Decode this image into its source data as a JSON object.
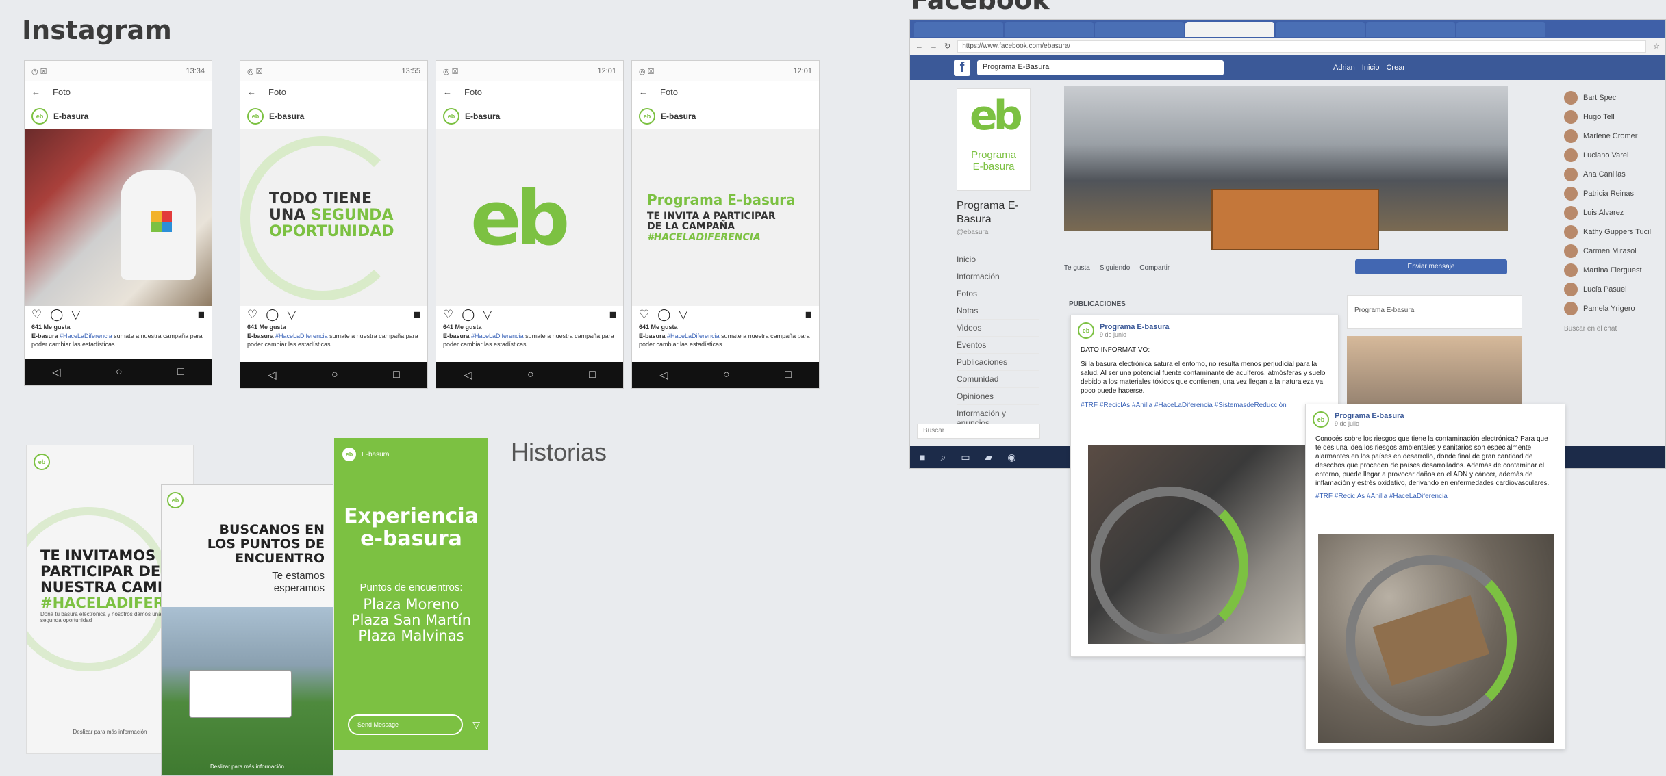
{
  "sections": {
    "instagram_title": "Instagram",
    "facebook_title": "Facebook",
    "stories_title": "Historias"
  },
  "colors": {
    "brand_green": "#7cc142",
    "fb_blue": "#3b5998",
    "bg": "#e9ebee"
  },
  "instagram_posts": [
    {
      "status_time": "13:34",
      "back_label": "Foto",
      "account": "E-basura",
      "likes": "641 Me gusta",
      "caption_account": "E-basura",
      "caption_tag": "#HaceLaDiferencia",
      "caption_rest": "sumate a nuestra campaña para poder cambiar las estadísticas"
    },
    {
      "status_time": "13:55",
      "back_label": "Foto",
      "account": "E-basura",
      "headline": [
        "TODO TIENE",
        "UNA ",
        "SEGUNDA",
        "OPORTUNIDAD"
      ],
      "likes": "641 Me gusta",
      "caption_account": "E-basura",
      "caption_tag": "#HaceLaDiferencia",
      "caption_rest": "sumate a nuestra campaña para poder cambiar las estadísticas"
    },
    {
      "status_time": "12:01",
      "back_label": "Foto",
      "account": "E-basura",
      "logo": "eb",
      "likes": "641 Me gusta",
      "caption_account": "E-basura",
      "caption_tag": "#HaceLaDiferencia",
      "caption_rest": "sumate a nuestra campaña para poder cambiar las estadísticas"
    },
    {
      "status_time": "12:01",
      "back_label": "Foto",
      "account": "E-basura",
      "headline_green": "Programa E-basura",
      "headline_dark": [
        "TE INVITA A PARTICIPAR",
        "DE LA CAMPAÑA"
      ],
      "headline_tag": "#HACELADIFERENCIA",
      "likes": "641 Me gusta",
      "caption_account": "E-basura",
      "caption_tag": "#HaceLaDiferencia",
      "caption_rest": "sumate a nuestra campaña para poder cambiar las estadísticas"
    }
  ],
  "stories": [
    {
      "text": [
        "TE INVITAMOS A",
        "PARTICIPAR DE",
        "NUESTRA CAMPAÑ"
      ],
      "tag": "#HACELADIFEREN",
      "small": "Dona tu basura electrónica y nosotros damos una segunda oportunidad",
      "footer": "Deslizar para más información"
    },
    {
      "text": [
        "BUSCANOS EN",
        "LOS PUNTOS DE",
        "ENCUENTRO"
      ],
      "sub": [
        "Te estamos",
        "esperamos"
      ],
      "footer": "Deslizar para más información"
    },
    {
      "account": "E-basura",
      "title": [
        "Experiencia",
        "e-basura"
      ],
      "subtitle": "Puntos de encuentros:",
      "places": [
        "Plaza Moreno",
        "Plaza San Martín",
        "Plaza Malvinas"
      ],
      "reply": "Send Message"
    }
  ],
  "facebook": {
    "url": "https://www.facebook.com/ebasura/",
    "search_value": "Programa E-Basura",
    "nav": [
      "Adrian",
      "Inicio",
      "Crear"
    ],
    "page_logo": "eb",
    "page_logo_text": [
      "Programa",
      "E-basura"
    ],
    "page_name": [
      "Programa E-",
      "Basura"
    ],
    "page_handle": "@ebasura",
    "sidebar": [
      "Inicio",
      "Información",
      "Fotos",
      "Notas",
      "Videos",
      "Eventos",
      "Publicaciones",
      "Comunidad",
      "Opiniones",
      "Información y anuncios"
    ],
    "actions": [
      "Te gusta",
      "Siguiendo",
      "Compartir",
      "Enviar mensaje"
    ],
    "posts_header": "PUBLICACIONES",
    "ad_text": "Programa E-basura",
    "friends": [
      "Bart Spec",
      "Hugo Tell",
      "Marlene Cromer",
      "Luciano Varel",
      "Ana Canillas",
      "Patricia Reinas",
      "Luis Alvarez",
      "Kathy Guppers Tucil",
      "Carmen Mirasol",
      "Martina Fierguest",
      "Lucía Pasuel",
      "Pamela Yrigero"
    ],
    "post1": {
      "account": "Programa E-basura",
      "meta": "9 de junio",
      "heading": "DATO INFORMATIVO:",
      "body": "Si la basura electrónica satura el entorno, no resulta menos perjudicial para la salud. Al ser una potencial fuente contaminante de acuíferos, atmósferas y suelo debido a los materiales tóxicos que contienen, una vez llegan a la naturaleza ya poco puede hacerse.",
      "tags": "#TRF #ReciclAs #Anilla #HaceLaDiferencia #SistemasdeReducción"
    },
    "post2": {
      "account": "Programa E-basura",
      "meta": "9 de julio",
      "body": "Conocés sobre los riesgos que tiene la contaminación electrónica? Para que te des una idea los riesgos ambientales y sanitarios son especialmente alarmantes en los países en desarrollo, donde final de gran cantidad de desechos que proceden de países desarrollados. Además de contaminar el entorno, puede llegar a provocar daños en el ADN y cáncer, además de inflamación y estrés oxidativo, derivando en enfermedades cardiovasculares.",
      "tags": "#TRF #ReciclAs #Anilla #HaceLaDiferencia"
    },
    "chat_search": "Buscar en el chat",
    "taskbar_search": "Buscar"
  }
}
